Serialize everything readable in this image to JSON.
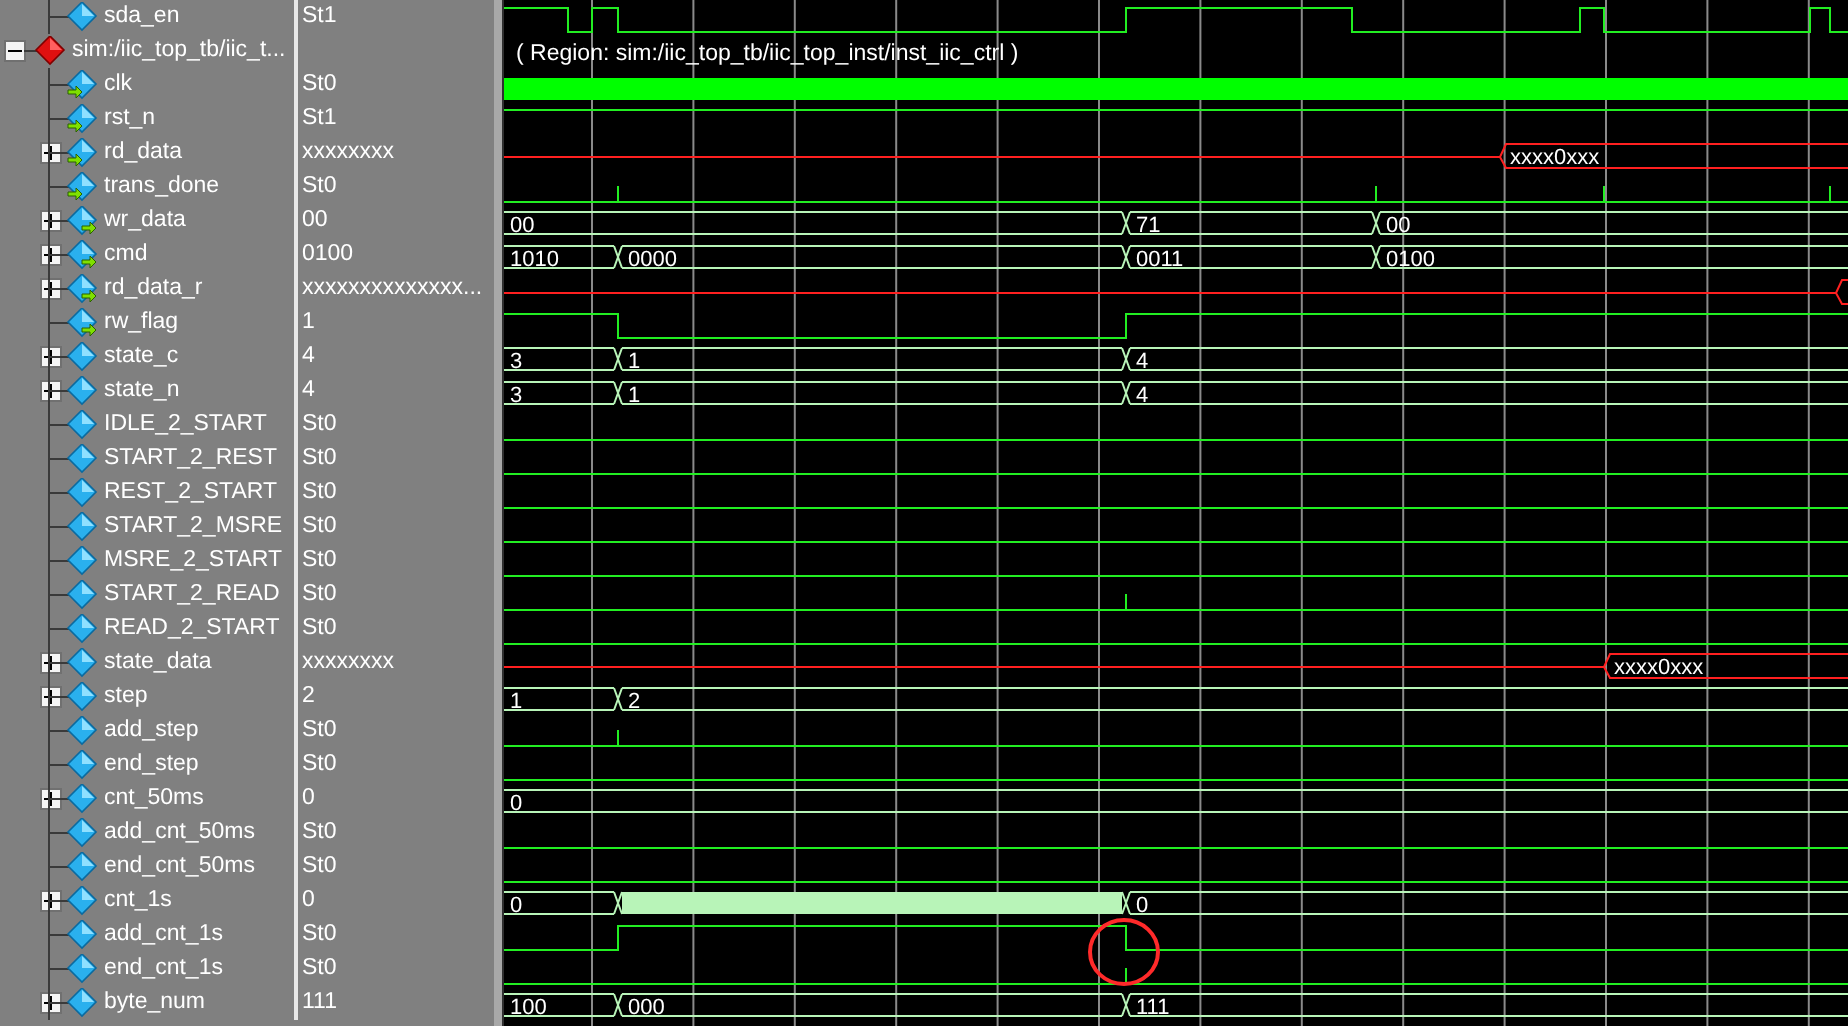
{
  "wave_window": {
    "signals": [
      {
        "name": "sda_en",
        "value": "St1",
        "input": false,
        "output": false,
        "kind": "bit"
      }
    ],
    "groups": [
      {
        "name": "sim:/iic_top_tb/iic_t...",
        "expanded": true,
        "region": "( Region: sim:/iic_top_tb/iic_top_inst/inst_iic_ctrl )",
        "children": [
          {
            "name": "clk",
            "value": "St0",
            "input": true,
            "output": false,
            "kind": "clock"
          },
          {
            "name": "rst_n",
            "value": "St1",
            "input": true,
            "output": false,
            "kind": "bit"
          },
          {
            "name": "rd_data",
            "value": "xxxxxxxx",
            "input": true,
            "output": false,
            "expanded": false,
            "kind": "unknown",
            "wave_labels": [
              "xxxx0xxx"
            ]
          },
          {
            "name": "trans_done",
            "value": "St0",
            "input": true,
            "output": false,
            "kind": "bit"
          },
          {
            "name": "wr_data",
            "value": "00",
            "input": false,
            "output": true,
            "expanded": false,
            "kind": "bus",
            "wave_labels": [
              "00",
              "71",
              "00"
            ]
          },
          {
            "name": "cmd",
            "value": "0100",
            "input": false,
            "output": true,
            "expanded": false,
            "kind": "bus",
            "wave_labels": [
              "1010",
              "0000",
              "0011",
              "0100"
            ]
          },
          {
            "name": "rd_data_r",
            "value": "xxxxxxxxxxxxxx...",
            "input": false,
            "output": true,
            "expanded": false,
            "kind": "unknown"
          },
          {
            "name": "rw_flag",
            "value": "1",
            "input": false,
            "output": true,
            "kind": "bit"
          },
          {
            "name": "state_c",
            "value": "4",
            "input": false,
            "output": false,
            "expanded": false,
            "kind": "bus",
            "wave_labels": [
              "3",
              "1",
              "4"
            ]
          },
          {
            "name": "state_n",
            "value": "4",
            "input": false,
            "output": false,
            "expanded": false,
            "kind": "bus",
            "wave_labels": [
              "3",
              "1",
              "4"
            ]
          },
          {
            "name": "IDLE_2_START",
            "value": "St0",
            "input": false,
            "output": false,
            "kind": "bit"
          },
          {
            "name": "START_2_REST",
            "value": "St0",
            "input": false,
            "output": false,
            "kind": "bit"
          },
          {
            "name": "REST_2_START",
            "value": "St0",
            "input": false,
            "output": false,
            "kind": "bit"
          },
          {
            "name": "START_2_MSRE",
            "value": "St0",
            "input": false,
            "output": false,
            "kind": "bit"
          },
          {
            "name": "MSRE_2_START",
            "value": "St0",
            "input": false,
            "output": false,
            "kind": "bit"
          },
          {
            "name": "START_2_READ",
            "value": "St0",
            "input": false,
            "output": false,
            "kind": "bit"
          },
          {
            "name": "READ_2_START",
            "value": "St0",
            "input": false,
            "output": false,
            "kind": "bit"
          },
          {
            "name": "state_data",
            "value": "xxxxxxxx",
            "input": false,
            "output": false,
            "expanded": false,
            "kind": "unknown",
            "wave_labels": [
              "xxxx0xxx"
            ]
          },
          {
            "name": "step",
            "value": "2",
            "input": false,
            "output": false,
            "expanded": false,
            "kind": "bus",
            "wave_labels": [
              "1",
              "2"
            ]
          },
          {
            "name": "add_step",
            "value": "St0",
            "input": false,
            "output": false,
            "kind": "bit"
          },
          {
            "name": "end_step",
            "value": "St0",
            "input": false,
            "output": false,
            "kind": "bit"
          },
          {
            "name": "cnt_50ms",
            "value": "0",
            "input": false,
            "output": false,
            "expanded": false,
            "kind": "bus",
            "wave_labels": [
              "0"
            ]
          },
          {
            "name": "add_cnt_50ms",
            "value": "St0",
            "input": false,
            "output": false,
            "kind": "bit"
          },
          {
            "name": "end_cnt_50ms",
            "value": "St0",
            "input": false,
            "output": false,
            "kind": "bit"
          },
          {
            "name": "cnt_1s",
            "value": "0",
            "input": false,
            "output": false,
            "expanded": false,
            "kind": "bus",
            "wave_labels": [
              "0",
              "0"
            ]
          },
          {
            "name": "add_cnt_1s",
            "value": "St0",
            "input": false,
            "output": false,
            "kind": "bit"
          },
          {
            "name": "end_cnt_1s",
            "value": "St0",
            "input": false,
            "output": false,
            "kind": "bit"
          },
          {
            "name": "byte_num",
            "value": "111",
            "input": false,
            "output": false,
            "expanded": false,
            "kind": "bus",
            "wave_labels": [
              "100",
              "000",
              "111"
            ]
          }
        ]
      }
    ]
  }
}
